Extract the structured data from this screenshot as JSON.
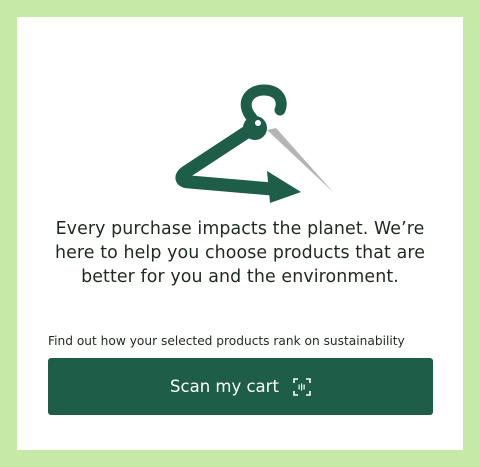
{
  "card": {
    "headline": "Every purchase impacts the planet. We’re here to help you choose products that are better for you and the environment.",
    "subtext": "Find out how your selected products rank on sustainability",
    "scan_button_label": "Scan my cart",
    "scan_icon": "barcode-scan-icon",
    "logo_icon": "hanger-arrow-icon"
  },
  "colors": {
    "page_background": "#c6e9a8",
    "card_background": "#ffffff",
    "brand_green": "#1e5d48",
    "logo_gray": "#b5b5b5",
    "text": "#1f2a20"
  }
}
